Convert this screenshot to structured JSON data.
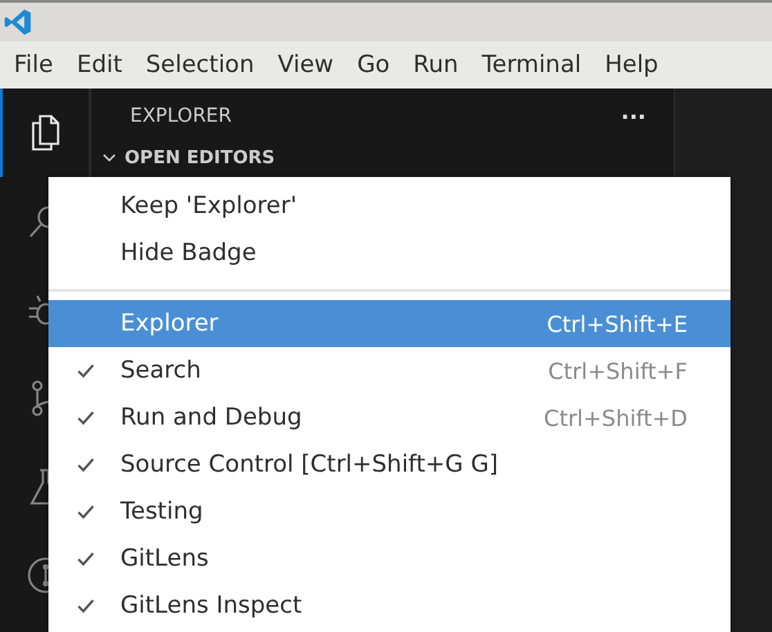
{
  "menubar": {
    "items": [
      "File",
      "Edit",
      "Selection",
      "View",
      "Go",
      "Run",
      "Terminal",
      "Help"
    ]
  },
  "sidebar": {
    "title": "EXPLORER",
    "more": "···",
    "section": {
      "label": "OPEN EDITORS",
      "expanded": true
    }
  },
  "activity_bar": {
    "items": [
      {
        "kind": "files",
        "selected": true
      },
      {
        "kind": "search",
        "selected": false
      },
      {
        "kind": "debug",
        "selected": false
      },
      {
        "kind": "source",
        "selected": false
      },
      {
        "kind": "testing",
        "selected": false
      },
      {
        "kind": "gitlens",
        "selected": false
      }
    ]
  },
  "context_menu": {
    "groups": [
      [
        {
          "label": "Keep 'Explorer'",
          "selected": false
        },
        {
          "label": "Hide Badge",
          "selected": false
        }
      ],
      [
        {
          "label": "Explorer",
          "shortcut": "Ctrl+Shift+E",
          "checked": false,
          "selected": true
        },
        {
          "label": "Search",
          "shortcut": "Ctrl+Shift+F",
          "checked": true,
          "selected": false
        },
        {
          "label": "Run and Debug",
          "shortcut": "Ctrl+Shift+D",
          "checked": true,
          "selected": false
        },
        {
          "label": "Source Control [Ctrl+Shift+G G]",
          "checked": true,
          "selected": false
        },
        {
          "label": "Testing",
          "checked": true,
          "selected": false
        },
        {
          "label": "GitLens",
          "checked": true,
          "selected": false
        },
        {
          "label": "GitLens Inspect",
          "checked": true,
          "selected": false
        }
      ]
    ]
  }
}
